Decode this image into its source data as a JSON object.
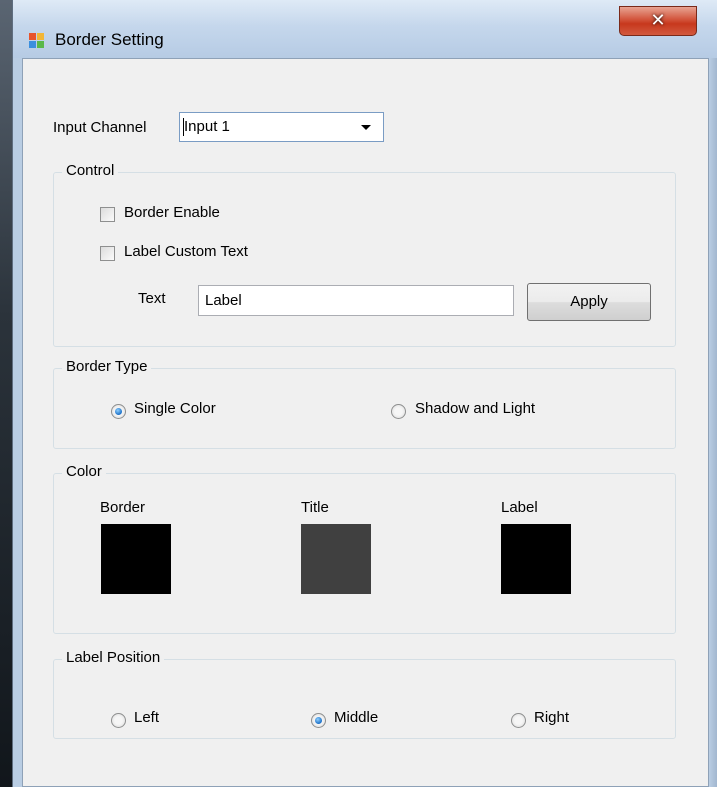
{
  "window": {
    "title": "Border Setting",
    "close_glyph": "✕"
  },
  "input_channel": {
    "label": "Input Channel",
    "selected": "Input 1"
  },
  "control": {
    "title": "Control",
    "border_enable_label": "Border Enable",
    "border_enable_checked": false,
    "label_custom_text_label": "Label Custom Text",
    "label_custom_text_checked": false,
    "text_label": "Text",
    "text_value": "Label",
    "apply_label": "Apply"
  },
  "border_type": {
    "title": "Border Type",
    "options": [
      {
        "label": "Single Color",
        "checked": true
      },
      {
        "label": "Shadow and Light",
        "checked": false
      }
    ]
  },
  "color": {
    "title": "Color",
    "swatches": [
      {
        "label": "Border",
        "color": "#000000"
      },
      {
        "label": "Title",
        "color": "#404040"
      },
      {
        "label": "Label",
        "color": "#000000"
      }
    ]
  },
  "label_position": {
    "title": "Label Position",
    "options": [
      {
        "label": "Left",
        "checked": false
      },
      {
        "label": "Middle",
        "checked": true
      },
      {
        "label": "Right",
        "checked": false
      }
    ]
  },
  "icons": {
    "app": "window-app-icon",
    "close": "close-icon",
    "dropdown": "chevron-down-icon"
  }
}
